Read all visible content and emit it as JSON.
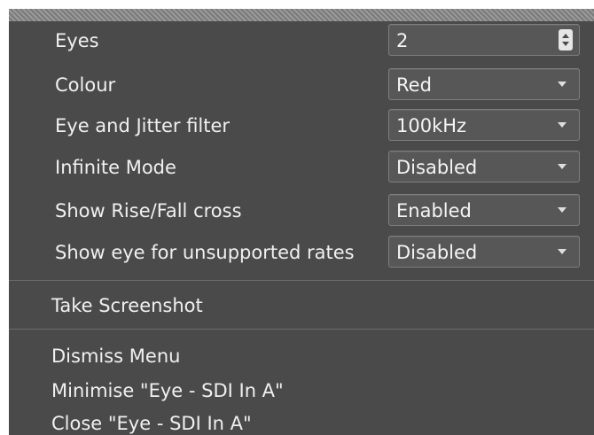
{
  "menu": {
    "settings": [
      {
        "label": "Eyes",
        "value": "2",
        "control": "spinbox"
      },
      {
        "label": "Colour",
        "value": "Red",
        "control": "dropdown"
      },
      {
        "label": "Eye and Jitter filter",
        "value": "100kHz",
        "control": "dropdown"
      },
      {
        "label": "Infinite Mode",
        "value": "Disabled",
        "control": "dropdown"
      },
      {
        "label": "Show Rise/Fall cross",
        "value": "Enabled",
        "control": "dropdown"
      },
      {
        "label": "Show eye for unsupported rates",
        "value": "Disabled",
        "control": "dropdown"
      }
    ],
    "actions": {
      "take_screenshot": "Take Screenshot",
      "dismiss": "Dismiss Menu",
      "minimise": "Minimise \"Eye - SDI In A\"",
      "close": "Close \"Eye - SDI In A\""
    },
    "icons": {
      "spinbox": "spin-arrows-icon",
      "dropdown": "chevron-down-icon"
    },
    "colors": {
      "menu_background": "#4a4a4a",
      "field_background": "#575757",
      "text": "#f0f0f0"
    }
  }
}
